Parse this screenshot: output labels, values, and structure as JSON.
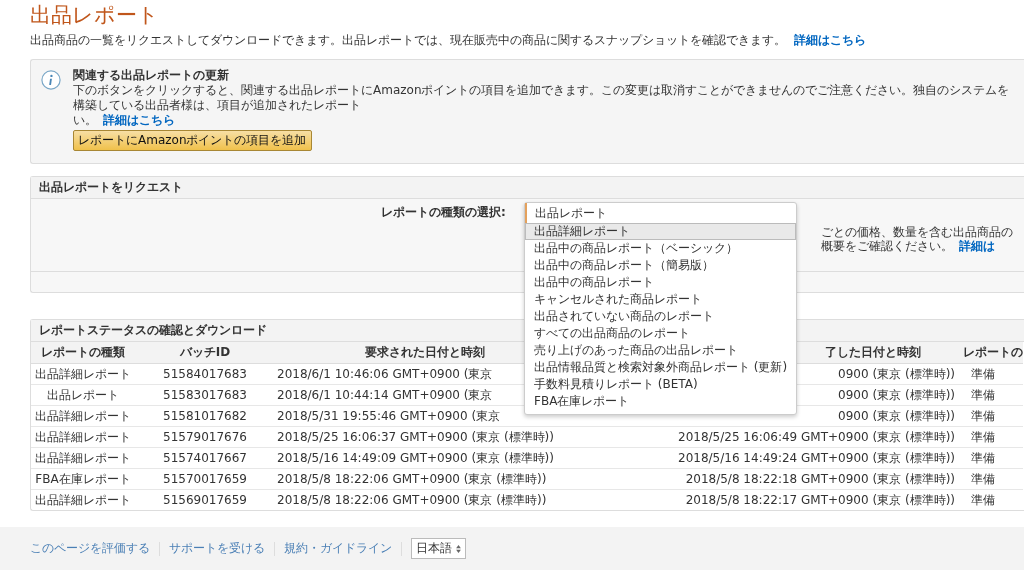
{
  "page": {
    "title": "出品レポート",
    "subtitle": "出品商品の一覧をリクエストしてダウンロードできます。出品レポートでは、現在販売中の商品に関するスナップショットを確認できます。",
    "subtitle_link": "詳細はこちら"
  },
  "notice": {
    "title": "関連する出品レポートの更新",
    "text_line_1": "下のボタンをクリックすると、関連する出品レポートにAmazonポイントの項目を追加できます。この変更は取消すことができませんのでご注意ください。独自のシステムを構築している出品者様は、項目が追加されたレポート",
    "text_line_2": "い。",
    "link": "詳細はこちら",
    "button": "レポートにAmazonポイントの項目を追加"
  },
  "request_panel": {
    "header": "出品レポートをリクエスト",
    "select_label": "レポートの種類の選択:",
    "select": {
      "value": "出品レポート",
      "options": [
        {
          "label": "出品詳細レポート",
          "selected": true
        },
        {
          "label": "出品中の商品レポート（ベーシック）",
          "selected": false
        },
        {
          "label": "出品中の商品レポート（簡易版）",
          "selected": false
        },
        {
          "label": "出品中の商品レポート",
          "selected": false
        },
        {
          "label": "キャンセルされた商品レポート",
          "selected": false
        },
        {
          "label": "出品されていない商品のレポート",
          "selected": false
        },
        {
          "label": "すべての出品商品のレポート",
          "selected": false
        },
        {
          "label": "売り上げのあった商品の出品レポート",
          "selected": false
        },
        {
          "label": "出品情報品質と検索対象外商品レポート (更新)",
          "selected": false
        },
        {
          "label": "手数料見積りレポート (BETA)",
          "selected": false
        },
        {
          "label": "FBA在庫レポート",
          "selected": false
        }
      ]
    },
    "description": "ごとの価格、数量を含む出品商品の概要をご確認ください。",
    "link": "詳細は"
  },
  "status_panel": {
    "header": "レポートステータスの確認とダウンロード",
    "columns": [
      "レポートの種類",
      "バッチID",
      "要求された日付と時刻",
      "了した日付と時刻",
      "レポートの"
    ],
    "rows": [
      [
        "出品詳細レポート",
        "51584017683",
        "2018/6/1 10:46:06 GMT+0900 (東京",
        "0900 (東京 (標準時))",
        "準備"
      ],
      [
        "出品レポート",
        "51583017683",
        "2018/6/1 10:44:14 GMT+0900 (東京",
        "0900 (東京 (標準時))",
        "準備"
      ],
      [
        "出品詳細レポート",
        "51581017682",
        "2018/5/31 19:55:46 GMT+0900 (東京",
        "0900 (東京 (標準時))",
        "準備"
      ],
      [
        "出品詳細レポート",
        "51579017676",
        "2018/5/25 16:06:37 GMT+0900 (東京 (標準時))",
        "2018/5/25 16:06:49 GMT+0900 (東京 (標準時))",
        "準備"
      ],
      [
        "出品詳細レポート",
        "51574017667",
        "2018/5/16 14:49:09 GMT+0900 (東京 (標準時))",
        "2018/5/16 14:49:24 GMT+0900 (東京 (標準時))",
        "準備"
      ],
      [
        "FBA在庫レポート",
        "51570017659",
        "2018/5/8 18:22:06 GMT+0900 (東京 (標準時))",
        "2018/5/8 18:22:18 GMT+0900 (東京 (標準時))",
        "準備"
      ],
      [
        "出品詳細レポート",
        "51569017659",
        "2018/5/8 18:22:06 GMT+0900 (東京 (標準時))",
        "2018/5/8 18:22:17 GMT+0900 (東京 (標準時))",
        "準備"
      ]
    ]
  },
  "footer": {
    "links": [
      "このページを評価する",
      "サポートを受ける",
      "規約・ガイドライン"
    ],
    "language": "日本語"
  }
}
